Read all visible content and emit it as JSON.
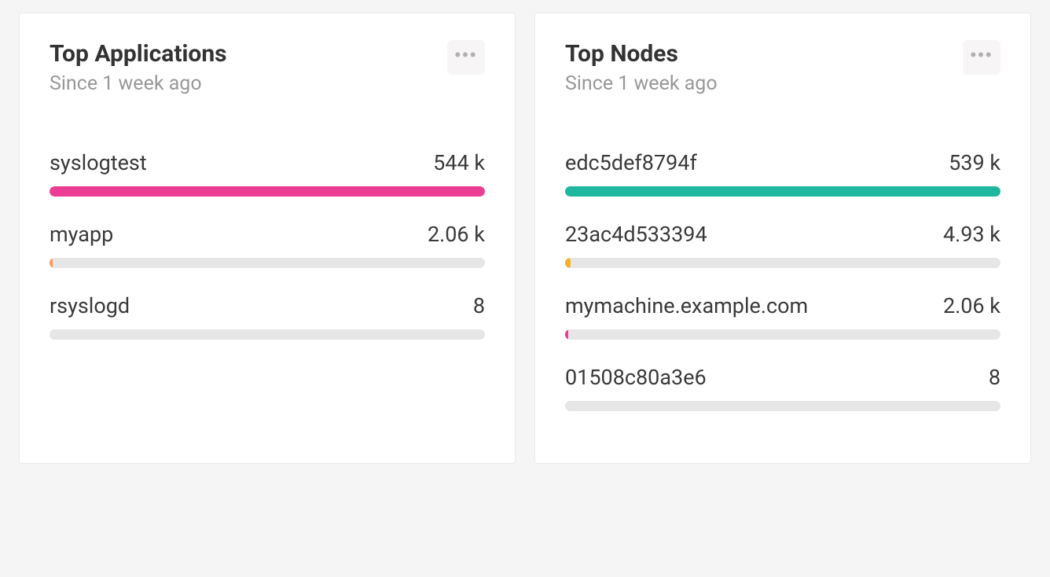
{
  "cards": [
    {
      "title": "Top Applications",
      "subtitle": "Since 1 week ago",
      "items": [
        {
          "label": "syslogtest",
          "value_display": "544 k",
          "value": 544000,
          "bar_pct": 100,
          "color": "#ec3d94"
        },
        {
          "label": "myapp",
          "value_display": "2.06 k",
          "value": 2060,
          "bar_pct": 0.6,
          "color": "#f69a5b"
        },
        {
          "label": "rsyslogd",
          "value_display": "8",
          "value": 8,
          "bar_pct": 0,
          "color": "#e6e6e6"
        }
      ]
    },
    {
      "title": "Top Nodes",
      "subtitle": "Since 1 week ago",
      "items": [
        {
          "label": "edc5def8794f",
          "value_display": "539 k",
          "value": 539000,
          "bar_pct": 100,
          "color": "#1fb89e"
        },
        {
          "label": "23ac4d533394",
          "value_display": "4.93 k",
          "value": 4930,
          "bar_pct": 1.2,
          "color": "#f2b127"
        },
        {
          "label": "mymachine.example.com",
          "value_display": "2.06 k",
          "value": 2060,
          "bar_pct": 0.6,
          "color": "#ec3d94"
        },
        {
          "label": "01508c80a3e6",
          "value_display": "8",
          "value": 8,
          "bar_pct": 0,
          "color": "#e6e6e6"
        }
      ]
    }
  ],
  "chart_data": [
    {
      "type": "bar",
      "title": "Top Applications",
      "subtitle": "Since 1 week ago",
      "categories": [
        "syslogtest",
        "myapp",
        "rsyslogd"
      ],
      "values": [
        544000,
        2060,
        8
      ],
      "display_values": [
        "544 k",
        "2.06 k",
        "8"
      ],
      "colors": [
        "#ec3d94",
        "#f69a5b",
        "#e6e6e6"
      ],
      "orientation": "horizontal",
      "xlabel": "",
      "ylabel": "",
      "ylim": [
        0,
        544000
      ]
    },
    {
      "type": "bar",
      "title": "Top Nodes",
      "subtitle": "Since 1 week ago",
      "categories": [
        "edc5def8794f",
        "23ac4d533394",
        "mymachine.example.com",
        "01508c80a3e6"
      ],
      "values": [
        539000,
        4930,
        2060,
        8
      ],
      "display_values": [
        "539 k",
        "4.93 k",
        "2.06 k",
        "8"
      ],
      "colors": [
        "#1fb89e",
        "#f2b127",
        "#ec3d94",
        "#e6e6e6"
      ],
      "orientation": "horizontal",
      "xlabel": "",
      "ylabel": "",
      "ylim": [
        0,
        539000
      ]
    }
  ]
}
